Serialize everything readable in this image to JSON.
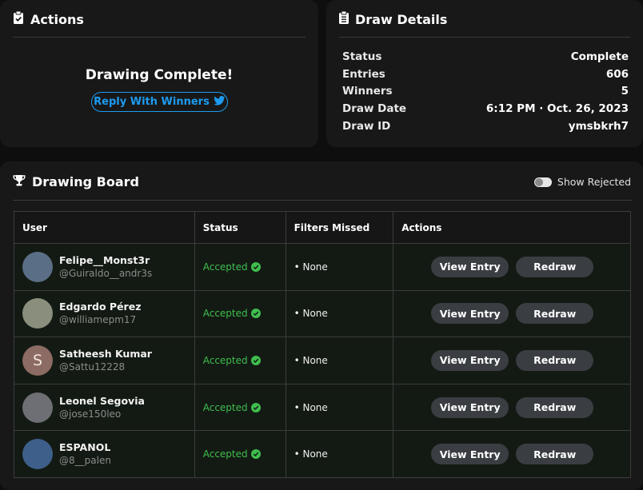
{
  "actions": {
    "title": "Actions",
    "icon": "clipboard-check-icon",
    "message": "Drawing Complete!",
    "reply_label": "Reply With Winners",
    "reply_icon": "twitter-icon",
    "accent": "#1d9bf0"
  },
  "details": {
    "title": "Draw Details",
    "icon": "clipboard-list-icon",
    "rows": [
      {
        "label": "Status",
        "value": "Complete"
      },
      {
        "label": "Entries",
        "value": "606"
      },
      {
        "label": "Winners",
        "value": "5"
      },
      {
        "label": "Draw Date",
        "value": "6:12 PM · Oct. 26, 2023"
      },
      {
        "label": "Draw ID",
        "value": "ymsbkrh7"
      }
    ]
  },
  "board": {
    "title": "Drawing Board",
    "icon": "trophy-icon",
    "toggle_label": "Show Rejected",
    "toggle_on": false,
    "columns": [
      "User",
      "Status",
      "Filters Missed",
      "Actions"
    ],
    "rows": [
      {
        "name": "Felipe__Monst3r",
        "handle": "@Guiraldo__andr3s",
        "status": "Accepted",
        "filters": "• None",
        "avatar_color": "#5a6f86",
        "avatar_letter": "",
        "view_label": "View Entry",
        "redraw_label": "Redraw"
      },
      {
        "name": "Edgardo Pérez",
        "handle": "@williamepm17",
        "status": "Accepted",
        "filters": "• None",
        "avatar_color": "#8a8f7d",
        "avatar_letter": "",
        "view_label": "View Entry",
        "redraw_label": "Redraw"
      },
      {
        "name": "Satheesh Kumar",
        "handle": "@Sattu12228",
        "status": "Accepted",
        "filters": "• None",
        "avatar_color": "#8b6b63",
        "avatar_letter": "S",
        "view_label": "View Entry",
        "redraw_label": "Redraw"
      },
      {
        "name": "Leonel Segovia",
        "handle": "@jose150leo",
        "status": "Accepted",
        "filters": "• None",
        "avatar_color": "#6d6f74",
        "avatar_letter": "",
        "view_label": "View Entry",
        "redraw_label": "Redraw"
      },
      {
        "name": "ESPANOL",
        "handle": "@8__palen",
        "status": "Accepted",
        "filters": "• None",
        "avatar_color": "#3d5f8a",
        "avatar_letter": "",
        "view_label": "View Entry",
        "redraw_label": "Redraw"
      }
    ],
    "status_color": "#3fbe4f"
  }
}
